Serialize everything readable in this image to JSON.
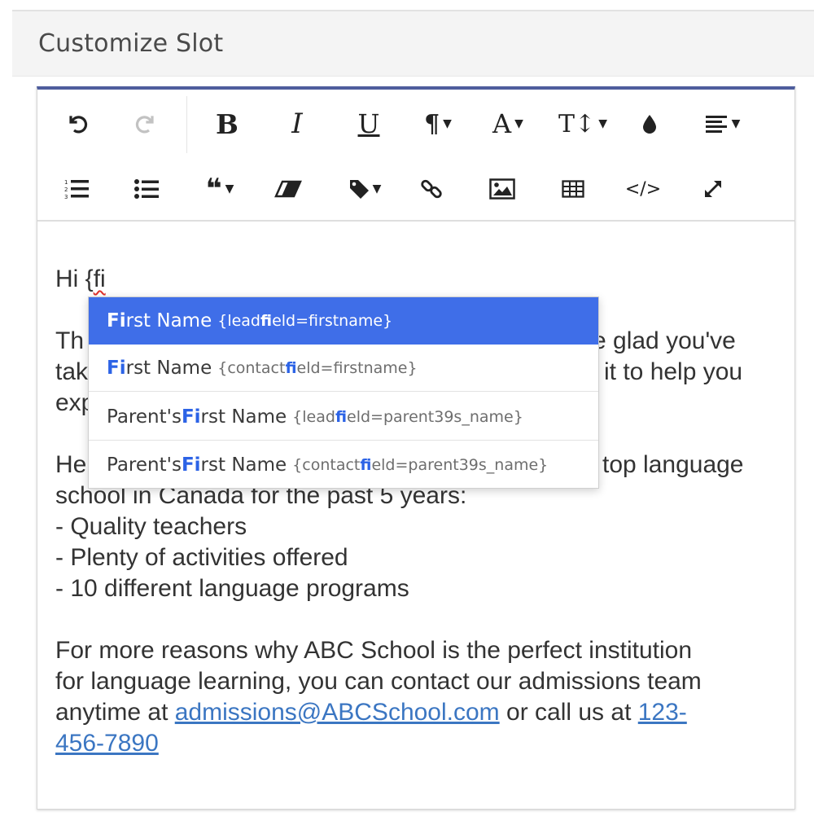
{
  "panel": {
    "title": "Customize Slot"
  },
  "toolbar": {
    "row1": [
      {
        "icon": "undo-icon",
        "glyph": "↺"
      },
      {
        "icon": "redo-icon",
        "glyph": "↻",
        "disabled": true
      },
      {
        "icon": "bold-icon",
        "glyph": "B"
      },
      {
        "icon": "italic-icon",
        "glyph": "I"
      },
      {
        "icon": "underline-icon",
        "glyph": "U"
      },
      {
        "icon": "paragraph-icon",
        "glyph": "¶",
        "dropdown": true
      },
      {
        "icon": "font-family-icon",
        "glyph": "A",
        "dropdown": true
      },
      {
        "icon": "font-size-icon",
        "glyph": "T↕",
        "dropdown": true
      },
      {
        "icon": "color-icon",
        "glyph": "💧"
      },
      {
        "icon": "align-icon",
        "glyph": "≡",
        "dropdown": true
      }
    ],
    "row2": [
      {
        "icon": "ordered-list-icon"
      },
      {
        "icon": "unordered-list-icon"
      },
      {
        "icon": "blockquote-icon",
        "dropdown": true
      },
      {
        "icon": "eraser-icon"
      },
      {
        "icon": "tag-icon",
        "dropdown": true
      },
      {
        "icon": "link-icon"
      },
      {
        "icon": "image-icon"
      },
      {
        "icon": "table-icon"
      },
      {
        "icon": "code-view-icon",
        "glyph": "</>"
      },
      {
        "icon": "fullscreen-icon"
      }
    ]
  },
  "editor": {
    "greeting_prefix": "Hi {",
    "greeting_typed": "fi",
    "p1_line1_left": "Th",
    "p1_line1_right": "e glad you've",
    "p1_line2_left": "tak",
    "p1_line2_right": "it to help you",
    "p1_line3_left": "exp",
    "p2_line1_left": "He",
    "p2_line1_right": "top language",
    "p2_line2": "school in Canada for the past 5 years:",
    "bullet1": "- Quality teachers",
    "bullet2": "- Plenty of activities offered",
    "bullet3": "- 10 different language programs",
    "p3_line1": "For more reasons why ABC School is the perfect institution",
    "p3_line2": "for language learning, you can contact our admissions team",
    "p3_line3_prefix": "anytime at ",
    "email_link": "admissions@ABCSchool.com",
    "p3_line3_mid": " or call us at ",
    "phone_part1": "123-",
    "phone_part2": "456-7890"
  },
  "autocomplete": {
    "items": [
      {
        "pre": "",
        "match": "Fi",
        "post": "rst Name",
        "field_pre": "{lead",
        "field_match": "fi",
        "field_post": "eld=firstname}",
        "active": true
      },
      {
        "pre": "",
        "match": "Fi",
        "post": "rst Name",
        "field_pre": "{contact",
        "field_match": "fi",
        "field_post": "eld=firstname}"
      },
      {
        "pre": "Parent's ",
        "match": "Fi",
        "post": "rst Name",
        "field_pre": "{lead",
        "field_match": "fi",
        "field_post": "eld=parent39s_name}"
      },
      {
        "pre": "Parent's ",
        "match": "Fi",
        "post": "rst Name",
        "field_pre": "{contact",
        "field_match": "fi",
        "field_post": "eld=parent39s_name}"
      }
    ]
  }
}
